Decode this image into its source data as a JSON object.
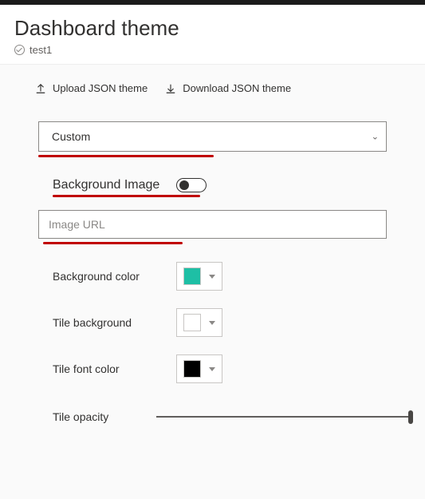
{
  "header": {
    "title": "Dashboard theme",
    "applied_name": "test1"
  },
  "actions": {
    "upload_label": "Upload JSON theme",
    "download_label": "Download JSON theme"
  },
  "theme_select": {
    "selected": "Custom"
  },
  "bgimage": {
    "label": "Background Image",
    "url_placeholder": "Image URL",
    "url_value": ""
  },
  "colors": {
    "background_label": "Background color",
    "background_value": "#1EBFA5",
    "tile_bg_label": "Tile background",
    "tile_bg_value": "#FFFFFF",
    "tile_font_label": "Tile font color",
    "tile_font_value": "#000000"
  },
  "opacity": {
    "label": "Tile opacity"
  }
}
